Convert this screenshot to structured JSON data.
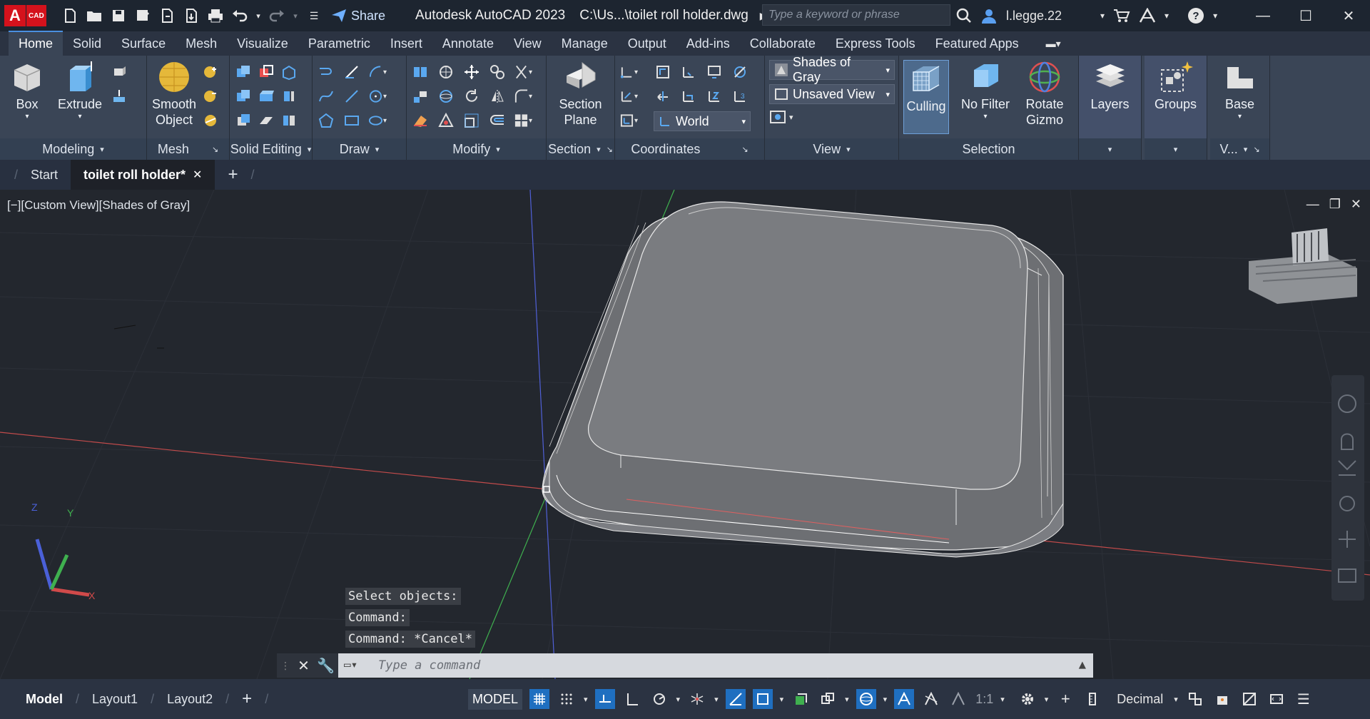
{
  "titlebar": {
    "logo_text": "A",
    "logo_sub": "CAD",
    "share_label": "Share",
    "app_name": "Autodesk AutoCAD 2023",
    "file_path": "C:\\Us...\\toilet roll holder.dwg",
    "search_placeholder": "Type a keyword or phrase",
    "username": "l.legge.22"
  },
  "ribbon_tabs": [
    "Home",
    "Solid",
    "Surface",
    "Mesh",
    "Visualize",
    "Parametric",
    "Insert",
    "Annotate",
    "View",
    "Manage",
    "Output",
    "Add-ins",
    "Collaborate",
    "Express Tools",
    "Featured Apps"
  ],
  "panels": {
    "modeling": {
      "title": "Modeling",
      "box": "Box",
      "extrude": "Extrude"
    },
    "mesh": {
      "title": "Mesh",
      "smooth_line1": "Smooth",
      "smooth_line2": "Object"
    },
    "solid_editing": {
      "title": "Solid Editing"
    },
    "draw": {
      "title": "Draw"
    },
    "modify": {
      "title": "Modify"
    },
    "section": {
      "title": "Section",
      "plane_line1": "Section",
      "plane_line2": "Plane"
    },
    "coordinates": {
      "title": "Coordinates",
      "world": "World"
    },
    "view": {
      "title": "View",
      "visual_style": "Shades of Gray",
      "saved_view": "Unsaved View"
    },
    "selection": {
      "title": "Selection",
      "culling": "Culling",
      "no_filter": "No Filter",
      "rotate_line1": "Rotate",
      "rotate_line2": "Gizmo"
    },
    "layers": {
      "label": "Layers"
    },
    "groups": {
      "label": "Groups"
    },
    "base": {
      "label": "Base",
      "title": "V..."
    }
  },
  "file_tabs": {
    "start": "Start",
    "active": "toilet roll holder*"
  },
  "viewport": {
    "label": "[−][Custom View][Shades of Gray]",
    "history": [
      "Select objects:",
      "Command:",
      "Command: *Cancel*"
    ],
    "command_placeholder": "Type a command"
  },
  "status": {
    "layouts": [
      "Model",
      "Layout1",
      "Layout2"
    ],
    "model_label": "MODEL",
    "scale": "1:1",
    "units": "Decimal"
  },
  "colors": {
    "accent": "#1f6fc0",
    "x_axis": "#d05050",
    "y_axis": "#3fb04f",
    "z_axis": "#5060d8"
  }
}
